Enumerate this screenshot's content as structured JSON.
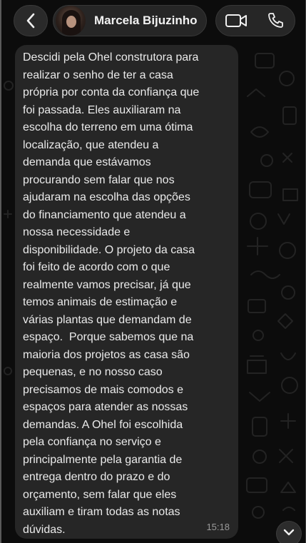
{
  "header": {
    "contact_name": "Marcela Bijuzinho",
    "back_icon": "chevron-left-icon",
    "video_icon": "video-camera-icon",
    "call_icon": "phone-icon"
  },
  "message": {
    "text": "Descidi pela Ohel construtora para\nrealizar o senho de ter a casa\nprópria por conta da confiança que\nfoi passada. Eles auxiliaram na\nescolha do terreno em uma ótima\nlocalização, que atendeu a\ndemanda que estávamos\nprocurando sem falar que nos\najudaram na escolha das opções\ndo financiamento que atendeu a\nnossa necessidade e\ndisponibilidade. O projeto da casa\nfoi feito de acordo com o que\nrealmente vamos precisar, já que\ntemos animais de estimação e\nvárias plantas que demandam de\nespaço.  Porque sabemos que na\nmaioria dos projetos as casa são\npequenas, e no nosso caso\nprecisamos de mais comodos e\nespaços para atender as nossas\ndemandas. A Ohel foi escolhida\npela confiança no serviço e\nprincipalmente pela garantia de\nentrega dentro do prazo e do\norçamento, sem falar que eles\nauxiliam e tiram todas as notas\ndúvidas.",
    "time": "15:18"
  },
  "scroll_down_icon": "chevron-down-icon",
  "colors": {
    "background": "#0c0c0c",
    "bubble": "#262626",
    "text": "#eaeaea",
    "timestamp": "#9a9a9a"
  }
}
